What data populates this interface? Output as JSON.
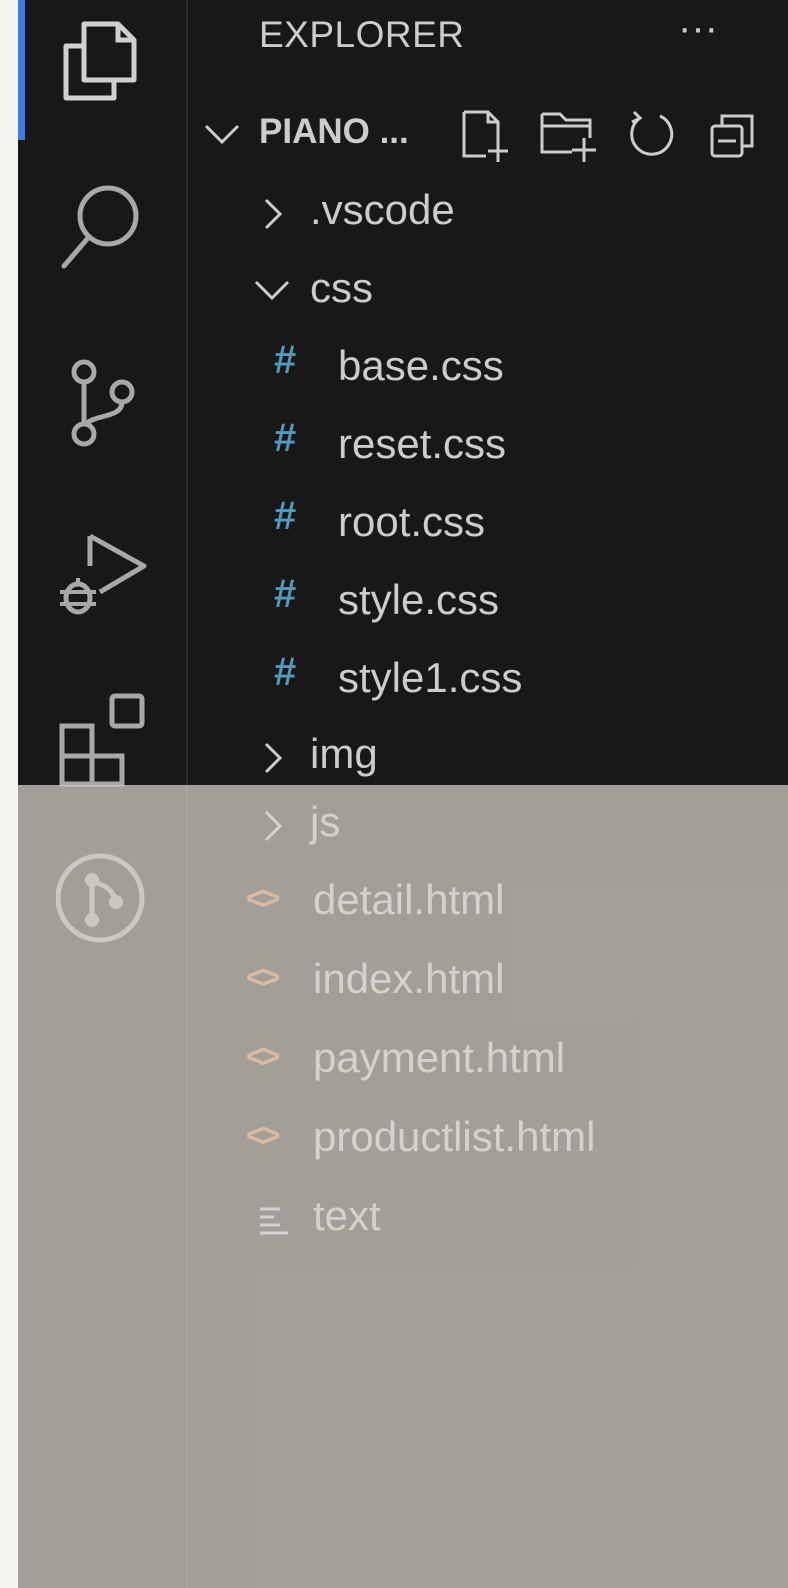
{
  "explorer": {
    "title": "EXPLORER",
    "more_label": "···",
    "section_title": "PIANO ...",
    "toolbar": [
      "new-file-icon",
      "new-folder-icon",
      "refresh-icon",
      "collapse-all-icon"
    ]
  },
  "activity_bar": {
    "items": [
      "explorer-icon",
      "search-icon",
      "source-control-icon",
      "run-debug-icon",
      "extensions-icon",
      "git-graph-icon"
    ],
    "active_color": "#3f78e8"
  },
  "tree": {
    "vscode": ".vscode",
    "css": "css",
    "css_files": [
      "base.css",
      "reset.css",
      "root.css",
      "style.css",
      "style1.css"
    ],
    "img": "img",
    "js": "js",
    "html_files": [
      "detail.html",
      "index.html",
      "payment.html",
      "productlist.html"
    ],
    "text": "text",
    "hash_glyph": "#",
    "code_glyph": "<>"
  },
  "colors": {
    "background": "#181818",
    "text": "#cccccc",
    "css_icon": "#519aba",
    "html_icon": "#e37933"
  }
}
